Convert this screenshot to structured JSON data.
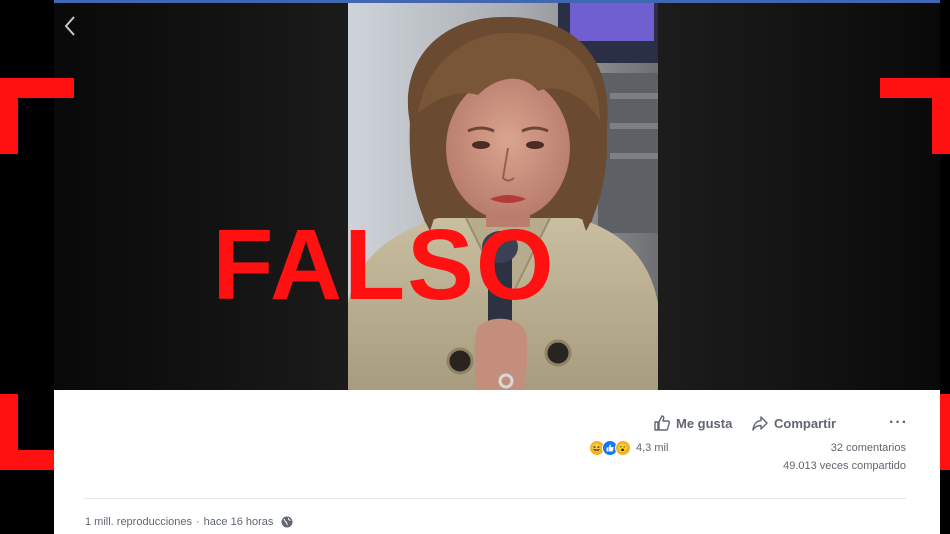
{
  "video": {
    "stamp_text": "FALSO"
  },
  "actions": {
    "like_label": "Me gusta",
    "share_label": "Compartir",
    "more_label": "···"
  },
  "reactions": {
    "count": "4,3 mil",
    "icons": [
      "haha-icon",
      "like-icon",
      "wow-icon"
    ]
  },
  "stats": {
    "comments": "32 comentarios",
    "shares": "49.013 veces compartido"
  },
  "meta": {
    "views": "1 mill. reproducciones",
    "separator": "·",
    "time": "hace 16 horas",
    "audience_icon": "globe-icon"
  },
  "colors": {
    "stamp": "#ff1111",
    "facebook_blue": "#4267b2",
    "text_secondary": "#606770"
  }
}
